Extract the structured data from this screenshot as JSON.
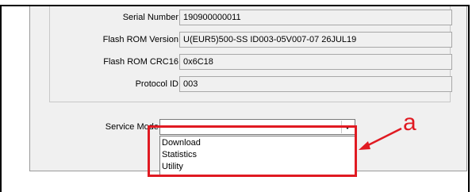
{
  "device_info": {
    "fields": [
      {
        "label": "Serial Number",
        "value": "190900000011"
      },
      {
        "label": "Flash ROM Version",
        "value": "U(EUR5)500-SS ID003-05V007-07 26JUL19"
      },
      {
        "label": "Flash ROM CRC16",
        "value": "0x6C18"
      },
      {
        "label": "Protocol ID",
        "value": "003"
      }
    ]
  },
  "service_mode": {
    "label": "Service Mode",
    "selected": "",
    "options": [
      "Download",
      "Statistics",
      "Utility"
    ]
  },
  "annotation": {
    "letter": "a",
    "color": "#e01a22"
  }
}
